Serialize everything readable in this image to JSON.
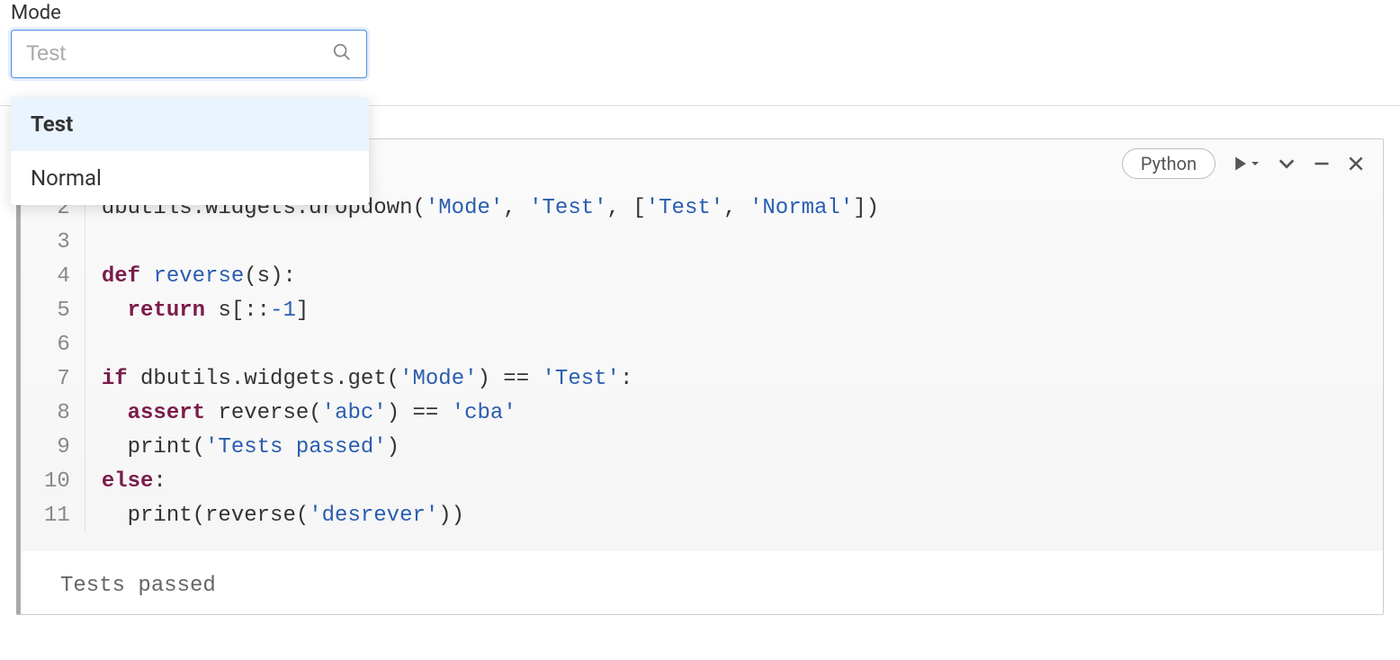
{
  "widget": {
    "label": "Mode",
    "placeholder": "Test",
    "options": [
      "Test",
      "Normal"
    ],
    "selected_index": 0
  },
  "cell": {
    "language": "Python",
    "line_numbers": [
      "2",
      "3",
      "4",
      "5",
      "6",
      "7",
      "8",
      "9",
      "10",
      "11"
    ],
    "code_lines": [
      {
        "tokens": [
          {
            "t": "dbutils.widgets.dropdown(",
            "c": "id"
          },
          {
            "t": "'Mode'",
            "c": "str"
          },
          {
            "t": ", ",
            "c": "id"
          },
          {
            "t": "'Test'",
            "c": "str"
          },
          {
            "t": ", [",
            "c": "id"
          },
          {
            "t": "'Test'",
            "c": "str"
          },
          {
            "t": ", ",
            "c": "id"
          },
          {
            "t": "'Normal'",
            "c": "str"
          },
          {
            "t": "])",
            "c": "id"
          }
        ]
      },
      {
        "tokens": [
          {
            "t": "",
            "c": "id"
          }
        ]
      },
      {
        "tokens": [
          {
            "t": "def",
            "c": "kw"
          },
          {
            "t": " ",
            "c": "id"
          },
          {
            "t": "reverse",
            "c": "fn"
          },
          {
            "t": "(s):",
            "c": "id"
          }
        ]
      },
      {
        "tokens": [
          {
            "t": "  ",
            "c": "id"
          },
          {
            "t": "return",
            "c": "kw"
          },
          {
            "t": " s[::",
            "c": "id"
          },
          {
            "t": "-1",
            "c": "num"
          },
          {
            "t": "]",
            "c": "id"
          }
        ]
      },
      {
        "tokens": [
          {
            "t": "",
            "c": "id"
          }
        ]
      },
      {
        "tokens": [
          {
            "t": "if",
            "c": "kw"
          },
          {
            "t": " dbutils.widgets.get(",
            "c": "id"
          },
          {
            "t": "'Mode'",
            "c": "str"
          },
          {
            "t": ") == ",
            "c": "id"
          },
          {
            "t": "'Test'",
            "c": "str"
          },
          {
            "t": ":",
            "c": "id"
          }
        ]
      },
      {
        "tokens": [
          {
            "t": "  ",
            "c": "id"
          },
          {
            "t": "assert",
            "c": "kw"
          },
          {
            "t": " reverse(",
            "c": "id"
          },
          {
            "t": "'abc'",
            "c": "str"
          },
          {
            "t": ") == ",
            "c": "id"
          },
          {
            "t": "'cba'",
            "c": "str"
          }
        ]
      },
      {
        "tokens": [
          {
            "t": "  print(",
            "c": "id"
          },
          {
            "t": "'Tests passed'",
            "c": "str"
          },
          {
            "t": ")",
            "c": "id"
          }
        ]
      },
      {
        "tokens": [
          {
            "t": "else",
            "c": "kw"
          },
          {
            "t": ":",
            "c": "id"
          }
        ]
      },
      {
        "tokens": [
          {
            "t": "  print(reverse(",
            "c": "id"
          },
          {
            "t": "'desrever'",
            "c": "str"
          },
          {
            "t": "))",
            "c": "id"
          }
        ]
      }
    ],
    "output": "Tests passed"
  }
}
